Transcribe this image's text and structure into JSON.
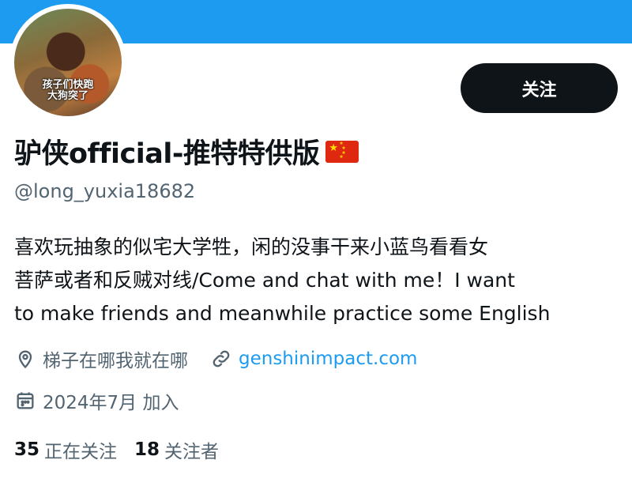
{
  "avatar": {
    "caption_line1": "孩子们快跑",
    "caption_line2": "大狗突了"
  },
  "follow_button": {
    "label": "关注"
  },
  "profile": {
    "display_name": "驴侠official-推特特供版",
    "flag": "china-flag-icon",
    "handle": "@long_yuxia18682"
  },
  "bio": {
    "line1": "喜欢玩抽象的似宅大学牲，闲的没事干来小蓝鸟看看女",
    "line2": "菩萨或者和反贼对线/Come and chat with me！I want",
    "line3": "to make friends and meanwhile practice some English"
  },
  "meta": {
    "location": "梯子在哪我就在哪",
    "website": "genshinimpact.com",
    "joined": "2024年7月 加入"
  },
  "stats": {
    "following_count": "35",
    "following_label": "正在关注",
    "followers_count": "18",
    "followers_label": "关注者"
  },
  "colors": {
    "banner": "#1d9bf0",
    "link": "#1d9bf0",
    "button": "#0f1419",
    "secondary_text": "#536471"
  }
}
